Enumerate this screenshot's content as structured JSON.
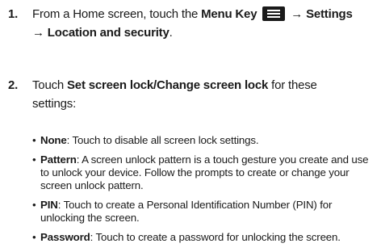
{
  "step1": {
    "number": "1.",
    "prefix": "From a Home screen, touch the ",
    "menu_key": "Menu Key",
    "arrow1": " → ",
    "settings": "Settings",
    "arrow2": "→ ",
    "location": "Location and security",
    "period": "."
  },
  "step2": {
    "number": "2.",
    "prefix": "Touch ",
    "set_lock": "Set screen lock/Change screen lock",
    "suffix": " for these",
    "line2": "settings:"
  },
  "bullets": [
    {
      "term": "None",
      "desc": ": Touch to disable all screen lock settings."
    },
    {
      "term": "Pattern",
      "desc": ": A screen unlock pattern is a touch gesture you create and use to unlock your device. Follow the prompts to create or change your screen unlock pattern."
    },
    {
      "term": "PIN",
      "desc": ": Touch to create a Personal Identification Number (PIN) for unlocking the screen."
    },
    {
      "term": "Password",
      "desc": ": Touch to create a password for unlocking the screen."
    }
  ],
  "bullet_symbol": "•",
  "icons": {
    "menu_key": "menu-key-icon"
  }
}
